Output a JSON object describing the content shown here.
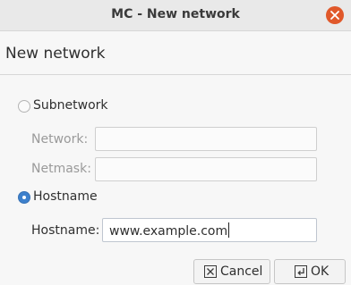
{
  "window": {
    "title": "MC - New network",
    "close_icon": "close-icon"
  },
  "header": {
    "title": "New network"
  },
  "subnetwork": {
    "label": "Subnetwork",
    "selected": false,
    "network_label": "Network:",
    "network_value": "",
    "netmask_label": "Netmask:",
    "netmask_value": ""
  },
  "hostname_option": {
    "label": "Hostname",
    "selected": true,
    "field_label": "Hostname:",
    "field_value": "www.example.com"
  },
  "buttons": {
    "cancel_label": "Cancel",
    "cancel_icon": "cancel-icon",
    "ok_label": "OK",
    "ok_icon": "enter-icon"
  },
  "colors": {
    "accent": "#3d80cc",
    "close": "#e0582a"
  }
}
